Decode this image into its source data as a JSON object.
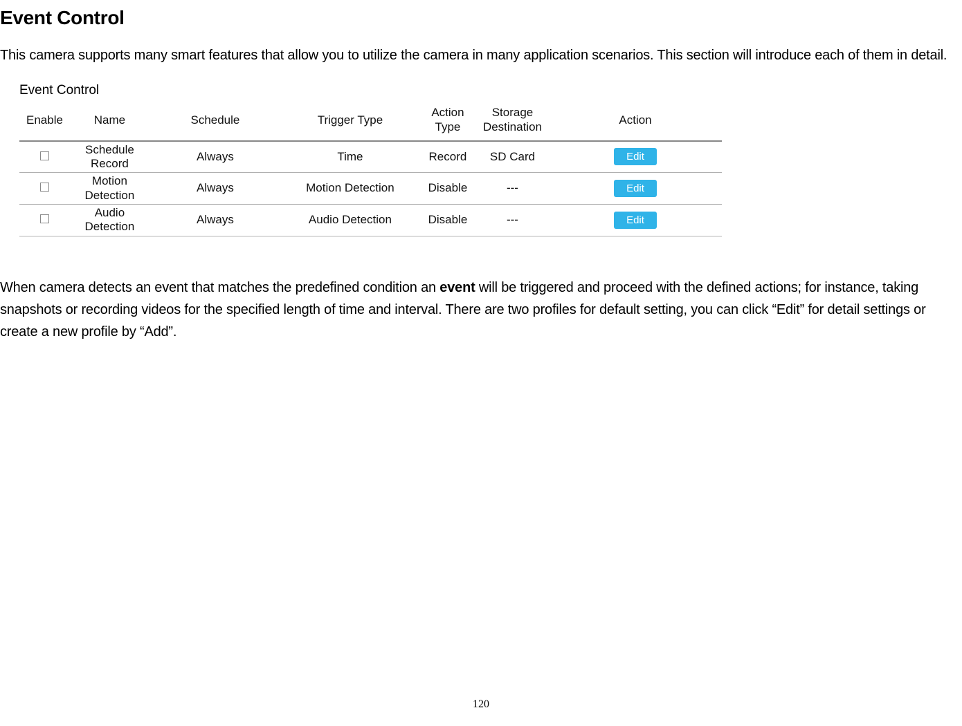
{
  "page_title": "Event Control",
  "intro_text": "This camera supports many smart features that allow you to utilize the camera in many application scenarios. This section will introduce each of them in detail.",
  "table_title": "Event Control",
  "table": {
    "headers": {
      "enable": "Enable",
      "name": "Name",
      "schedule": "Schedule",
      "trigger_type": "Trigger Type",
      "action_type": "Action\nType",
      "storage_destination": "Storage\nDestination",
      "action": "Action"
    },
    "rows": [
      {
        "name": "Schedule\nRecord",
        "schedule": "Always",
        "trigger_type": "Time",
        "action_type": "Record",
        "storage_destination": "SD Card",
        "edit_label": "Edit"
      },
      {
        "name": "Motion\nDetection",
        "schedule": "Always",
        "trigger_type": "Motion Detection",
        "action_type": "Disable",
        "storage_destination": "---",
        "edit_label": "Edit"
      },
      {
        "name": "Audio\nDetection",
        "schedule": "Always",
        "trigger_type": "Audio Detection",
        "action_type": "Disable",
        "storage_destination": "---",
        "edit_label": "Edit"
      }
    ]
  },
  "body_text_parts": {
    "p1": "When camera detects an event that matches the predefined condition an ",
    "bold": "event",
    "p2": " will be triggered and proceed with the defined actions; for instance, taking snapshots or recording videos for the specified length of time and interval. There are two profiles for default setting, you can click “Edit” for detail settings or create a new profile by “Add”."
  },
  "page_number": "120"
}
